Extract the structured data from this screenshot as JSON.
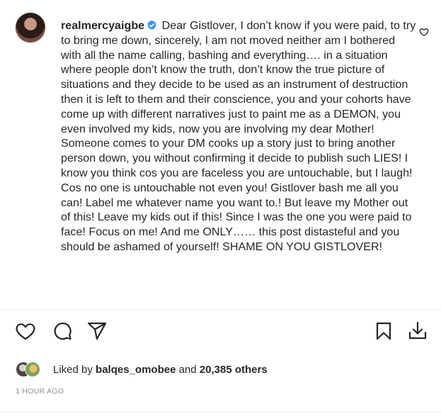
{
  "post": {
    "username": "realmercyaigbe",
    "verified_icon": "verified-badge-icon",
    "caption": "Dear Gistlover, I don’t know if you were paid, to try to bring me down, sincerely, I am not moved neither am I bothered with all the name calling, bashing and everything…. in a situation where people don’t know the truth, don’t know the true picture of situations and they decide to be used as an instrument of destruction then it is left to them and their conscience, you and your cohorts have come up with different narratives just to paint me as a DEMON, you even involved my kids, now you are involving my dear Mother! Someone comes to your DM cooks up a story just to bring another person down, you without confirming it decide to publish such LIES! I know you think cos you are faceless you are untouchable, but I laugh! Cos no one is untouchable not even you! Gistlover bash me all you can! Label me whatever name you want to.! But leave my Mother out of this! Leave my kids out if this! Since I was the one you were paid to face! Focus on me! And me ONLY…… this post distasteful and you should be ashamed of yourself! SHAME ON YOU GISTLOVER!",
    "caption_like_icon": "heart-outline-icon"
  },
  "actions": {
    "like_icon": "heart-icon",
    "comment_icon": "comment-icon",
    "share_icon": "paper-plane-icon",
    "save_icon": "bookmark-icon",
    "download_icon": "download-icon"
  },
  "likes": {
    "prefix": "Liked by",
    "user": "balqes_omobee",
    "connector": "and",
    "count": "20,385 others"
  },
  "timestamp": "1 HOUR AGO",
  "colors": {
    "text": "#262626",
    "muted": "#8e8e8e",
    "divider": "#efefef",
    "verified": "#3897f0"
  }
}
